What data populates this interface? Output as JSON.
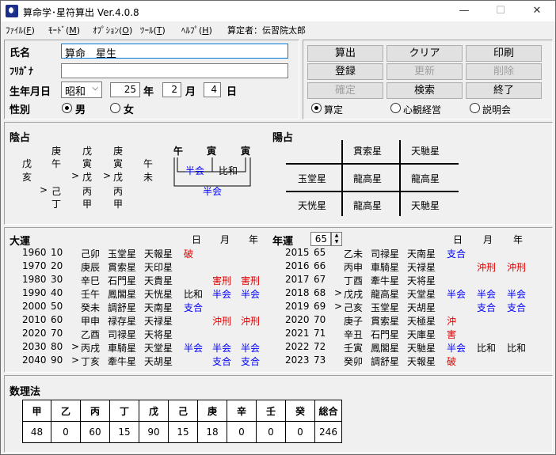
{
  "window": {
    "title": "算命学･星符算出  Ver.4.0.8",
    "controls": [
      "—",
      "☐",
      "✕"
    ]
  },
  "menu": [
    {
      "label": "ﾌｧｲﾙ(",
      "key": "F",
      "end": ")"
    },
    {
      "label": "ﾓｰﾄﾞ(",
      "key": "M",
      "end": ")"
    },
    {
      "label": "ｵﾌﾟｼｮﾝ(",
      "key": "O",
      "end": ")"
    },
    {
      "label": "ﾂｰﾙ(",
      "key": "T",
      "end": ")"
    },
    {
      "label": "ﾍﾙﾌﾟ(",
      "key": "H",
      "end": ")"
    }
  ],
  "calculator": "算定者：伝習院太郎",
  "form": {
    "name_label": "氏名",
    "name_value": "算命　星生",
    "kana_label": "ﾌﾘｶﾞﾅ",
    "kana_value": "",
    "birth_label": "生年月日",
    "era": "昭和",
    "year": "25",
    "year_unit": "年",
    "month": "2",
    "month_unit": "月",
    "day": "4",
    "day_unit": "日",
    "gender_label": "性別",
    "male": "男",
    "female": "女"
  },
  "buttons": {
    "calc": "算出",
    "clear": "クリア",
    "print": "印刷",
    "register": "登録",
    "update": "更新",
    "delete": "削除",
    "confirm": "確定",
    "search": "検索",
    "exit": "終了"
  },
  "modes": [
    "算定",
    "心観経営",
    "説明会"
  ],
  "inyou": {
    "title": "陰占",
    "heading": [
      "庚",
      "戊",
      "庚"
    ],
    "row1": [
      "戊",
      "午",
      "寅",
      "寅",
      "午"
    ],
    "row2": [
      "亥",
      "戊",
      "戊",
      "未"
    ],
    "row3": [
      "己",
      "丙",
      "丙"
    ],
    "row4": [
      "丁",
      "甲",
      "甲"
    ],
    "arrow": ">",
    "branches": [
      "午",
      "寅",
      "寅"
    ],
    "hankai": "半会",
    "hiwa": "比和",
    "hankai2": "半会"
  },
  "youzen": {
    "title": "陽占",
    "grid": [
      [
        "",
        "貫索星",
        "天馳星"
      ],
      [
        "玉堂星",
        "龍高星",
        "龍高星"
      ],
      [
        "天恍星",
        "龍高星",
        "天馳星"
      ]
    ]
  },
  "taiun": {
    "title": "大運",
    "cols": [
      "日",
      "月",
      "年"
    ],
    "rows": [
      {
        "y": "1960",
        "a": "10",
        "arrow": "",
        "k": "己卯",
        "s1": "玉堂星",
        "s2": "天報星",
        "r1": "破",
        "r2": "",
        "r3": "",
        "r4": ""
      },
      {
        "y": "1970",
        "a": "20",
        "arrow": "",
        "k": "庚辰",
        "s1": "貫索星",
        "s2": "天印星",
        "r1": "",
        "r2": "",
        "r3": "",
        "r4": ""
      },
      {
        "y": "1980",
        "a": "30",
        "arrow": "",
        "k": "辛巳",
        "s1": "石門星",
        "s2": "天貴星",
        "r1": "",
        "r2": "害刑",
        "r3": "害刑",
        "r4": ""
      },
      {
        "y": "1990",
        "a": "40",
        "arrow": "",
        "k": "壬午",
        "s1": "鳳閣星",
        "s2": "天恍星",
        "r1": "比和",
        "r2": "半会",
        "r3": "半会",
        "r4": ""
      },
      {
        "y": "2000",
        "a": "50",
        "arrow": "",
        "k": "癸未",
        "s1": "調舒星",
        "s2": "天南星",
        "r1": "支合",
        "r2": "",
        "r3": "",
        "r4": ""
      },
      {
        "y": "2010",
        "a": "60",
        "arrow": "",
        "k": "甲申",
        "s1": "禄存星",
        "s2": "天禄星",
        "r1": "",
        "r2": "沖刑",
        "r3": "沖刑",
        "r4": ""
      },
      {
        "y": "2020",
        "a": "70",
        "arrow": "",
        "k": "乙酉",
        "s1": "司禄星",
        "s2": "天将星",
        "r1": "",
        "r2": "",
        "r3": "",
        "r4": ""
      },
      {
        "y": "2030",
        "a": "80",
        "arrow": ">",
        "k": "丙戌",
        "s1": "車騎星",
        "s2": "天堂星",
        "r1": "半会",
        "r2": "半会",
        "r3": "半会",
        "r4": ""
      },
      {
        "y": "2040",
        "a": "90",
        "arrow": ">",
        "k": "丁亥",
        "s1": "牽牛星",
        "s2": "天胡星",
        "r1": "",
        "r2": "支合",
        "r3": "支合",
        "r4": ""
      }
    ]
  },
  "nenun": {
    "title": "年運",
    "age": "65",
    "cols": [
      "日",
      "月",
      "年"
    ],
    "rows": [
      {
        "y": "2015",
        "a": "65",
        "arrow": "",
        "k": "乙未",
        "s1": "司禄星",
        "s2": "天南星",
        "r1": "支合",
        "r2": "",
        "r3": ""
      },
      {
        "y": "2016",
        "a": "66",
        "arrow": "",
        "k": "丙申",
        "s1": "車騎星",
        "s2": "天禄星",
        "r1": "",
        "r2": "沖刑",
        "r3": "沖刑"
      },
      {
        "y": "2017",
        "a": "67",
        "arrow": "",
        "k": "丁酉",
        "s1": "牽牛星",
        "s2": "天将星",
        "r1": "",
        "r2": "",
        "r3": ""
      },
      {
        "y": "2018",
        "a": "68",
        "arrow": ">",
        "k": "戊戌",
        "s1": "龍高星",
        "s2": "天堂星",
        "r1": "半会",
        "r2": "半会",
        "r3": "半会"
      },
      {
        "y": "2019",
        "a": "69",
        "arrow": ">",
        "k": "己亥",
        "s1": "玉堂星",
        "s2": "天胡星",
        "r1": "",
        "r2": "支合",
        "r3": "支合"
      },
      {
        "y": "2020",
        "a": "70",
        "arrow": "",
        "k": "庚子",
        "s1": "貫索星",
        "s2": "天極星",
        "r1": "沖",
        "r2": "",
        "r3": ""
      },
      {
        "y": "2021",
        "a": "71",
        "arrow": "",
        "k": "辛丑",
        "s1": "石門星",
        "s2": "天庫星",
        "r1": "害",
        "r2": "",
        "r3": ""
      },
      {
        "y": "2022",
        "a": "72",
        "arrow": "",
        "k": "壬寅",
        "s1": "鳳閣星",
        "s2": "天馳星",
        "r1": "半会",
        "r2": "比和",
        "r3": "比和"
      },
      {
        "y": "2023",
        "a": "73",
        "arrow": "",
        "k": "癸卯",
        "s1": "調舒星",
        "s2": "天報星",
        "r1": "破",
        "r2": "",
        "r3": ""
      }
    ]
  },
  "suri": {
    "title": "数理法",
    "headers": [
      "甲",
      "乙",
      "丙",
      "丁",
      "戊",
      "己",
      "庚",
      "辛",
      "壬",
      "癸",
      "総合"
    ],
    "values": [
      "48",
      "0",
      "60",
      "15",
      "90",
      "15",
      "18",
      "0",
      "0",
      "0",
      "246"
    ]
  },
  "colors": {
    "red": "#e00000",
    "blue": "#0000ff"
  }
}
